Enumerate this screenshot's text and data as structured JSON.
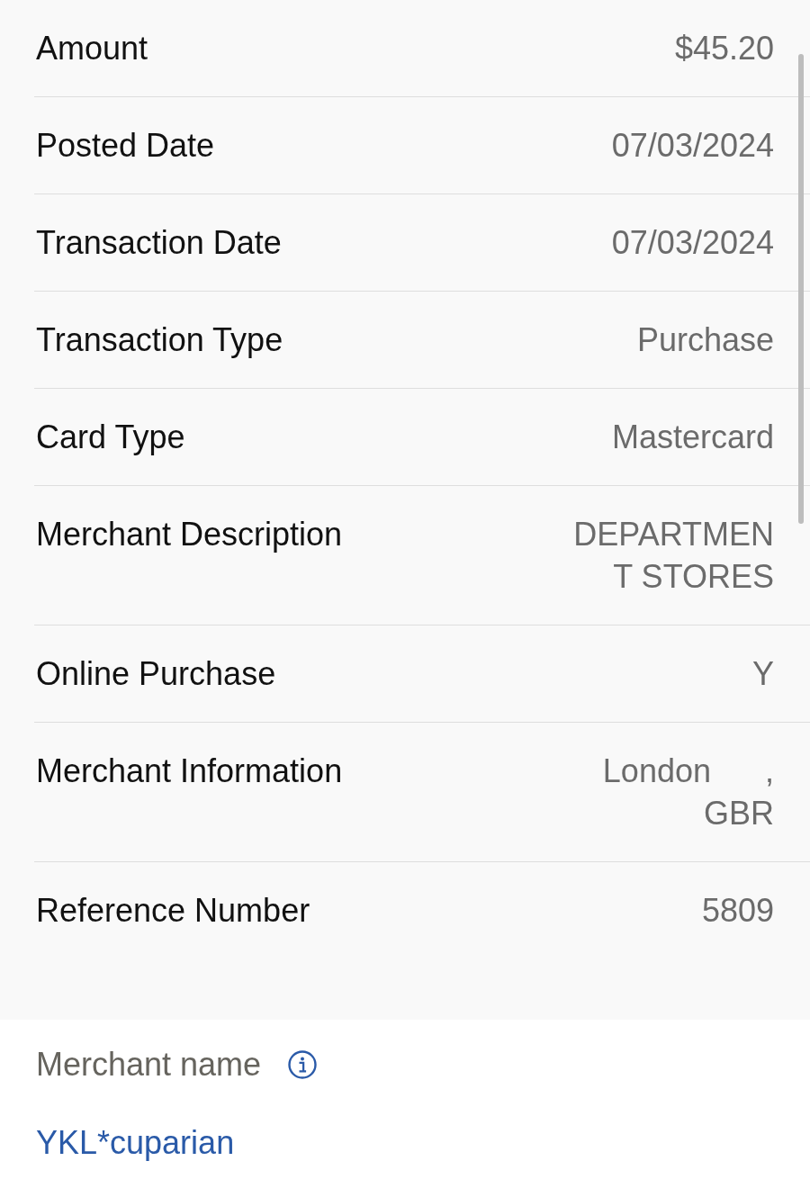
{
  "details": [
    {
      "label": "Amount",
      "value": "$45.20"
    },
    {
      "label": "Posted Date",
      "value": "07/03/2024"
    },
    {
      "label": "Transaction Date",
      "value": "07/03/2024"
    },
    {
      "label": "Transaction Type",
      "value": "Purchase"
    },
    {
      "label": "Card Type",
      "value": "Mastercard"
    },
    {
      "label": "Merchant Description",
      "value": "DEPARTMENT STORES"
    },
    {
      "label": "Online Purchase",
      "value": "Y"
    },
    {
      "label": "Merchant Information",
      "value": "London      , GBR"
    },
    {
      "label": "Reference Number",
      "value": "5809"
    }
  ],
  "merchant_name": {
    "label": "Merchant name",
    "value": "YKL*cuparian"
  }
}
